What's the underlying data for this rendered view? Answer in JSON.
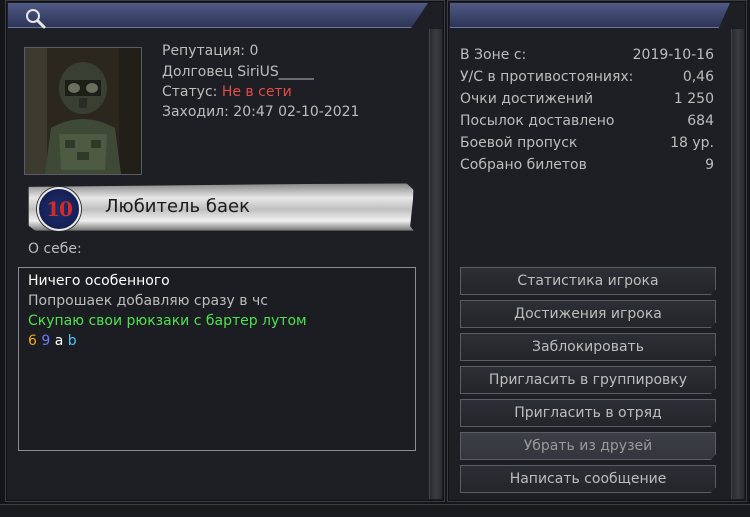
{
  "profile": {
    "reputation": "Репутация: 0",
    "name": "Долговец SiriUS_____",
    "status_label": "Статус: ",
    "status_value": "Не в сети",
    "last_seen": "Заходил: 20:47 02-10-2021"
  },
  "title_badge": {
    "level": "10",
    "title": "Любитель баек"
  },
  "about": {
    "label": "О себе:",
    "lines": [
      {
        "text": "Ничего особенного",
        "color": "#ffffff"
      },
      {
        "text": "Попрошаек добавляю сразу в чс",
        "color": "#bdbdbd"
      },
      {
        "text": "Скупаю свои рюкзаки с бартер лутом",
        "color": "#4ee24e"
      }
    ],
    "colored_tokens": [
      {
        "text": "6",
        "color": "#f5a623"
      },
      {
        "text": "9",
        "color": "#6f7bf7"
      },
      {
        "text": "a",
        "color": "#ffffff"
      },
      {
        "text": "b",
        "color": "#4fc3f7"
      }
    ]
  },
  "stats": [
    {
      "label": "В Зоне с:",
      "value": "2019-10-16"
    },
    {
      "label": "У/С в противостояниях:",
      "value": "0,46"
    },
    {
      "label": "Очки достижений",
      "value": "1 250"
    },
    {
      "label": "Посылок доставлено",
      "value": "684"
    },
    {
      "label": "Боевой пропуск",
      "value": "18 ур."
    },
    {
      "label": "Собрано билетов",
      "value": "9"
    }
  ],
  "buttons": [
    "Статистика игрока",
    "Достижения игрока",
    "Заблокировать",
    "Пригласить в группировку",
    "Пригласить в отряд",
    "Убрать из друзей",
    "Написать сообщение"
  ],
  "colors": {
    "header": "#3c456c",
    "status_offline": "#e34a4a"
  },
  "icons": {
    "search": "search-icon"
  }
}
